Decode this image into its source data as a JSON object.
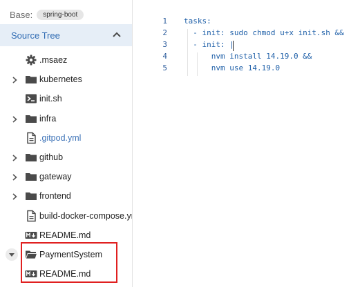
{
  "sidebar": {
    "base_label": "Base:",
    "branch": "spring-boot",
    "section_title": "Source Tree",
    "items": [
      {
        "label": ".msaez",
        "icon": "gear-icon",
        "arrow": false
      },
      {
        "label": "kubernetes",
        "icon": "folder-icon",
        "arrow": true
      },
      {
        "label": "init.sh",
        "icon": "terminal-icon",
        "arrow": false
      },
      {
        "label": "infra",
        "icon": "folder-icon",
        "arrow": true
      },
      {
        "label": ".gitpod.yml",
        "icon": "file-icon",
        "arrow": false,
        "selected": true
      },
      {
        "label": "github",
        "icon": "folder-icon",
        "arrow": true
      },
      {
        "label": "gateway",
        "icon": "folder-icon",
        "arrow": true
      },
      {
        "label": "frontend",
        "icon": "folder-icon",
        "arrow": true
      },
      {
        "label": "build-docker-compose.yml",
        "icon": "file-icon",
        "arrow": false
      },
      {
        "label": "README.md",
        "icon": "markdown-icon",
        "arrow": false
      },
      {
        "label": "PaymentSystem",
        "icon": "folder-open-icon",
        "arrow": true,
        "expanded": true
      },
      {
        "label": "README.md",
        "icon": "markdown-icon",
        "arrow": false
      }
    ]
  },
  "editor": {
    "lines": [
      {
        "num": "1",
        "text": "tasks:"
      },
      {
        "num": "2",
        "text": "  - init: sudo chmod u+x init.sh &&"
      },
      {
        "num": "3",
        "text": "  - init: |"
      },
      {
        "num": "4",
        "text": "      nvm install 14.19.0 &&"
      },
      {
        "num": "5",
        "text": "      nvm use 14.19.0"
      }
    ]
  },
  "colors": {
    "accent": "#2f6bb3",
    "selected_text": "#3f74b8",
    "highlight": "#e02020",
    "code": "#1e5fa8"
  }
}
